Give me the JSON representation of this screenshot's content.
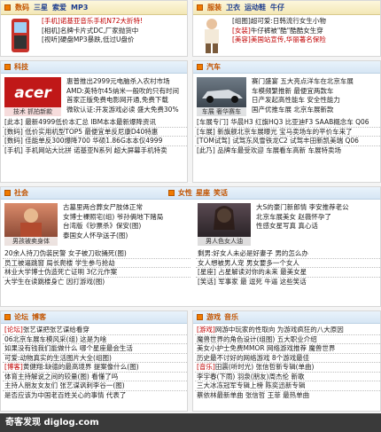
{
  "topleft": {
    "headers": [
      "数码",
      "三星",
      "索爱",
      "MP3"
    ],
    "lines": [
      {
        "tag": "[手机]",
        "text": "诺基亚音乐手机N72大折特!"
      },
      {
        "tag": "[相机]",
        "text": "名牌卡片式DC,厂家抛货中"
      },
      {
        "tag": "[视听]",
        "text": "硬盘MP3暴跌,低过U盘价"
      }
    ]
  },
  "topright": {
    "headers": [
      "服装",
      "卫衣",
      "运动鞋",
      "牛仔"
    ],
    "lines": [
      {
        "tag": "[组图]",
        "text": "超可爱:日韩流行女生小物"
      },
      {
        "tag": "[女装]",
        "text": "牛仔裤被\"酷\"酷酷女生穿"
      },
      {
        "tag": "[美容]",
        "text": "美国站宣传,华丽著名保险"
      }
    ]
  },
  "tech": {
    "header": "科技",
    "image_label": "acer",
    "image_caption": "技术 抓拍新款",
    "lines": [
      "惠普推出2999元电脑杀入农村市场",
      "AMD:英特尔45纳米一般吹的只有时间",
      "首家正版免费电影网开通,免费下载",
      "微软认证:开发游戏必读 盛大免费30%",
      "[此本] 最新4999低价本汇总 IBM本本最新爆降资讯",
      "[数码] 低价实用机型TOP5 最便宜单反尼康D40特惠",
      "[数码] 佳能单反300爆降700 华硕1.86G本本仅4999",
      "[手机] 手机网站大比拼 诺基亚N系列 超大屏幕手机特卖"
    ]
  },
  "car": {
    "header": "汽车",
    "image_caption": "车展 奢华赛车",
    "lines": [
      "赛门盛宴 五大亮点洋车在北京车展",
      "车模频繁推新 最便宜两款车",
      "日产发起高性能车 安全性能力",
      "国产优推车展 北京车展新款",
      "[车展专门] 华晨H3 红旗HQ3 比亚迪F3 SAAB概念车 Q06",
      "[车展] 新旗舰北京车展曝光 宝马卖场车的平价车来了",
      "[TOM试驾] 试驾东风雪铁龙C2 试驾丰田新凯美瑞 Q06",
      "[此乃] 品牌车最受欢迎 车展看车高新 车展特卖场"
    ]
  },
  "social": {
    "headers": [
      "社会",
      "女性",
      "星座",
      "笑话"
    ],
    "left_caption": "男孩被卖身体",
    "right_caption": "男人色女人油",
    "left_lines": [
      "古墓里两合葬女尸肢体正常",
      "女博士裸照宅(组) 爷孙俩地下赌局",
      "台湾版《钞票杀》保安(图)",
      "泰国女人怀孕送子(图)",
      "20余人持刀伪装民警 女子被刀砍捅死(图)",
      "员工被逼跳窗 局长爬楼 学生参与抢劫",
      "林业大学博士伪造死亡证明 3亿元作案",
      "大学生在读跳楼身亡 因打游戏(图)"
    ],
    "right_lines": [
      "大S的豪门新郎情 李安推荐老公",
      "北京车展美女 赵薇怀孕了",
      "性感女星写真 真心话",
      "剩男:好女人未必是好妻子 男的怎么办",
      "女人想被男人宠 男女要多一个女人",
      "[星座] 占星解读对你的未来 最美女星",
      "[笑话] 军事家 最 逗死 牛逼 这些笑话"
    ]
  },
  "forum": {
    "headers": [
      "论坛",
      "博客"
    ],
    "lines": [
      {
        "tag": "[论坛]",
        "text": "张艺谋把张艺谋给看穿"
      },
      {
        "tag": "",
        "text": "06北京车展车模风采(组) 这是为啥"
      },
      {
        "tag": "",
        "text": "如果没有钱我们能做什么 哪个星座最会生活"
      },
      {
        "tag": "",
        "text": "可爱:动物真实的生活图片大全(组图)"
      },
      {
        "tag": "[博客]",
        "text": "黄健翔:缺德的最高境界 提案像什么(图)"
      },
      {
        "tag": "",
        "text": "体育主持解说之间的较量(图) 看懂了吗"
      },
      {
        "tag": "",
        "text": "主持人朋友女友们 张艺谋讽刺李谷一(图)"
      },
      {
        "tag": "",
        "text": "是否应该为中国老百姓关心的事情 代表了"
      }
    ]
  },
  "game": {
    "headers": [
      "游戏",
      "音乐"
    ],
    "lines": [
      {
        "tag": "[游戏]",
        "text": "网游中玩家的性取向 为游戏疯狂的八大原因"
      },
      {
        "tag": "",
        "text": "魔兽世界的角色设计(组图) 五大职业介绍"
      },
      {
        "tag": "",
        "text": "美女小护士免费MMOR 网络游戏推荐 魔兽世界"
      },
      {
        "tag": "",
        "text": "历史最不讨好的网络游戏 8个游戏最佳"
      },
      {
        "tag": "[音乐]",
        "text": "田震(听时光) 张信哲新专辑(单曲)"
      },
      {
        "tag": "",
        "text": "李宇春(下雨) 羽泉(朋友)周杰伦 新歌"
      },
      {
        "tag": "",
        "text": "三大冰冻冠军专辑上榜 陈奕迅新专辑"
      },
      {
        "tag": "",
        "text": "蔡依林最新单曲 张信哲 王菲 最热单曲"
      }
    ]
  },
  "footer": {
    "text": "奇客发现 diglog.com"
  }
}
